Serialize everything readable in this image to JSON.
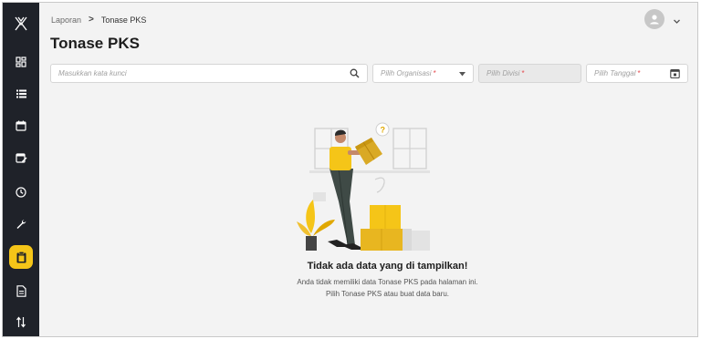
{
  "sidebar": {
    "logo_icon": "x-logo-icon",
    "items": [
      {
        "name": "dashboard",
        "icon": "dashboard-icon"
      },
      {
        "name": "list",
        "icon": "list-icon"
      },
      {
        "name": "calendar",
        "icon": "calendar-icon"
      },
      {
        "name": "calendar-edit",
        "icon": "calendar-edit-icon"
      },
      {
        "name": "clock",
        "icon": "clock-icon"
      },
      {
        "name": "wrench",
        "icon": "wrench-icon"
      },
      {
        "name": "clipboard",
        "icon": "clipboard-icon",
        "active": true
      },
      {
        "name": "document",
        "icon": "document-icon"
      },
      {
        "name": "compare",
        "icon": "compare-arrows-icon"
      }
    ],
    "accent_color": "#f5c518",
    "background": "#1f2229"
  },
  "breadcrumb": {
    "parent": "Laporan",
    "separator": ">",
    "current": "Tonase PKS"
  },
  "page": {
    "title": "Tonase PKS"
  },
  "filters": {
    "search_placeholder": "Masukkan kata kunci",
    "organisasi_placeholder": "Pilih Organisasi",
    "divisi_placeholder": "Pilih Divisi",
    "tanggal_placeholder": "Pilih Tanggal",
    "required_mark": "*"
  },
  "empty_state": {
    "title": "Tidak ada data yang di tampilkan!",
    "line1": "Anda tidak memiliki data Tonase PKS pada halaman ini.",
    "line2": "Pilih Tonase PKS atau buat data baru."
  }
}
